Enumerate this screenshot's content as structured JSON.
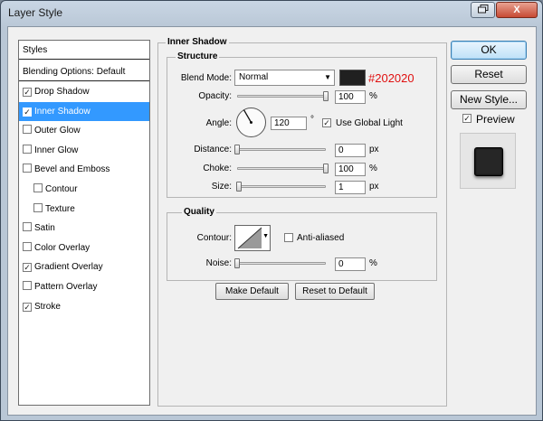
{
  "window": {
    "title": "Layer Style",
    "restore_icon": "restore-icon",
    "close_icon": "close-icon",
    "close_glyph": "X"
  },
  "styles_list": {
    "header": "Styles",
    "blending_options": "Blending Options: Default",
    "items": [
      {
        "label": "Drop Shadow",
        "checked": true,
        "selected": false,
        "sub": false
      },
      {
        "label": "Inner Shadow",
        "checked": true,
        "selected": true,
        "sub": false
      },
      {
        "label": "Outer Glow",
        "checked": false,
        "selected": false,
        "sub": false
      },
      {
        "label": "Inner Glow",
        "checked": false,
        "selected": false,
        "sub": false
      },
      {
        "label": "Bevel and Emboss",
        "checked": false,
        "selected": false,
        "sub": false
      },
      {
        "label": "Contour",
        "checked": false,
        "selected": false,
        "sub": true
      },
      {
        "label": "Texture",
        "checked": false,
        "selected": false,
        "sub": true
      },
      {
        "label": "Satin",
        "checked": false,
        "selected": false,
        "sub": false
      },
      {
        "label": "Color Overlay",
        "checked": false,
        "selected": false,
        "sub": false
      },
      {
        "label": "Gradient Overlay",
        "checked": true,
        "selected": false,
        "sub": false
      },
      {
        "label": "Pattern Overlay",
        "checked": false,
        "selected": false,
        "sub": false
      },
      {
        "label": "Stroke",
        "checked": true,
        "selected": false,
        "sub": false
      }
    ]
  },
  "inner_shadow": {
    "section_title": "Inner Shadow",
    "structure": {
      "title": "Structure",
      "blend_mode_label": "Blend Mode:",
      "blend_mode_value": "Normal",
      "color_swatch": "#202020",
      "color_annotation": "#202020",
      "annotation_color": "#e01010",
      "opacity_label": "Opacity:",
      "opacity_value": "100",
      "opacity_unit": "%",
      "opacity_level": 1.0,
      "angle_label": "Angle:",
      "angle_value": "120",
      "angle_unit": "°",
      "angle_degrees": 120,
      "use_global_light_label": "Use Global Light",
      "use_global_light_checked": true,
      "distance_label": "Distance:",
      "distance_value": "0",
      "distance_unit": "px",
      "distance_level": 0.0,
      "choke_label": "Choke:",
      "choke_value": "100",
      "choke_unit": "%",
      "choke_level": 1.0,
      "size_label": "Size:",
      "size_value": "1",
      "size_unit": "px",
      "size_level": 0.02
    },
    "quality": {
      "title": "Quality",
      "contour_label": "Contour:",
      "anti_aliased_label": "Anti-aliased",
      "anti_aliased_checked": false,
      "noise_label": "Noise:",
      "noise_value": "0",
      "noise_unit": "%",
      "noise_level": 0.0
    },
    "make_default_label": "Make Default",
    "reset_to_default_label": "Reset to Default"
  },
  "right_buttons": {
    "ok_label": "OK",
    "reset_label": "Reset",
    "new_style_label": "New Style...",
    "preview_label": "Preview",
    "preview_checked": true
  }
}
